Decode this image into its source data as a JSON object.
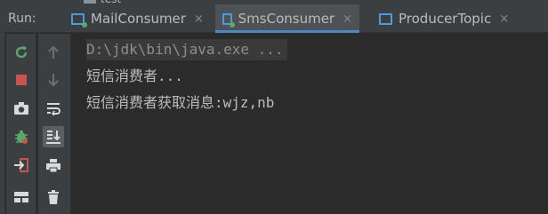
{
  "tree_item": {
    "label": "test"
  },
  "run_panel": {
    "label": "Run:",
    "tabs": [
      {
        "label": "MailConsumer",
        "active": false
      },
      {
        "label": "SmsConsumer",
        "active": true
      },
      {
        "label": "ProducerTopic",
        "active": false
      }
    ],
    "close_glyph": "×"
  },
  "toolbar_left": [
    "rerun-icon",
    "stop-icon",
    "camera-icon",
    "debug-bug-icon",
    "exit-icon",
    "layout-icon"
  ],
  "toolbar_right": [
    "arrow-up-icon",
    "arrow-down-icon",
    "soft-wrap-icon",
    "scroll-to-end-icon",
    "print-icon",
    "trash-icon"
  ],
  "console": {
    "lines": [
      "D:\\jdk\\bin\\java.exe ...",
      "短信消费者...",
      "短信消费者获取消息:wjz,nb"
    ]
  },
  "colors": {
    "accent": "#4a88c7",
    "rerun_green": "#59a869",
    "stop_red": "#c75450",
    "background": "#2b2b2b"
  }
}
